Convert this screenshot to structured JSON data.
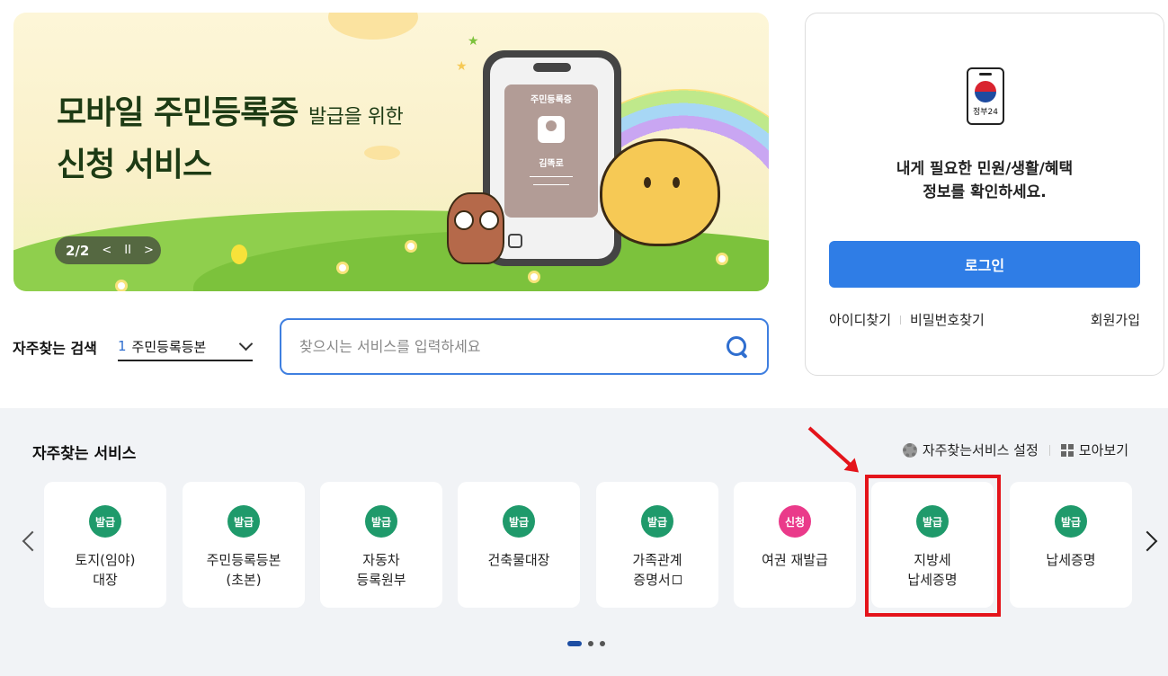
{
  "banner": {
    "title_line1": "모바일 주민등록증",
    "title_line1_small": "발급을 위한",
    "title_line2": "신청 서비스",
    "card_title": "주민등록증",
    "card_name": "김똑로",
    "pager": {
      "current": "2/2",
      "prev": "<",
      "pause": "II",
      "next": ">"
    }
  },
  "login": {
    "logo_text": "정부24",
    "message_line1": "내게 필요한 민원/생활/혜택",
    "message_line2": "정보를 확인하세요.",
    "login_button": "로그인",
    "find_id": "아이디찾기",
    "find_password": "비밀번호찾기",
    "signup": "회원가입"
  },
  "search": {
    "fav_label": "자주찾는 검색",
    "fav_rank": "1",
    "fav_value": "주민등록등본",
    "placeholder": "찾으시는 서비스를 입력하세요"
  },
  "services": {
    "title": "자주찾는 서비스",
    "settings_label": "자주찾는서비스 설정",
    "view_all_label": "모아보기",
    "items": [
      {
        "badge": "발급",
        "label": "토지(임야)\n대장",
        "color": "#1f9a6b"
      },
      {
        "badge": "발급",
        "label": "주민등록등본\n(초본)",
        "color": "#1f9a6b"
      },
      {
        "badge": "발급",
        "label": "자동차\n등록원부",
        "color": "#1f9a6b"
      },
      {
        "badge": "발급",
        "label": "건축물대장",
        "color": "#1f9a6b"
      },
      {
        "badge": "발급",
        "label": "가족관계\n증명서",
        "color": "#1f9a6b"
      },
      {
        "badge": "신청",
        "label": "여권 재발급",
        "color": "#ea3a8a"
      },
      {
        "badge": "발급",
        "label": "지방세\n납세증명",
        "color": "#1f9a6b"
      },
      {
        "badge": "발급",
        "label": "납세증명",
        "color": "#1f9a6b"
      }
    ]
  }
}
